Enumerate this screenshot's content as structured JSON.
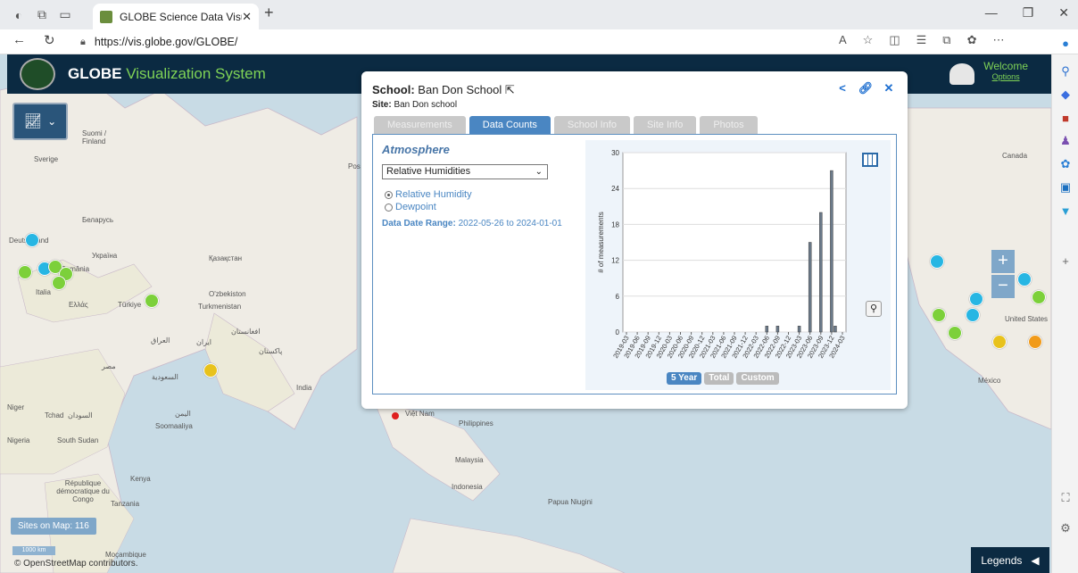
{
  "browser": {
    "tab_title": "GLOBE Science Data Visualizatio",
    "url": "https://vis.globe.gov/GLOBE/"
  },
  "app": {
    "title_main": "GLOBE",
    "title_sub": "Visualization System",
    "welcome": "Welcome",
    "options": "Options",
    "sites_on_map": "Sites on Map: 116",
    "scale": "1000 km",
    "attribution": "© OpenStreetMap contributors.",
    "legends": "Legends"
  },
  "map_labels": [
    "Suomi / Finland",
    "Sverige",
    "Беларусь",
    "Україна",
    "Қазақстан",
    "Italia",
    "România",
    "Ελλάς",
    "Türkiye",
    "O'zbekiston",
    "Turkmenistan",
    "العراق",
    "ایران",
    "افغانستان",
    "پاکستان",
    "مصر",
    "السعودية",
    "India",
    "Niger",
    "Tchad",
    "السودان",
    "اليمن",
    "Nigeria",
    "South Sudan",
    "Soomaaliya",
    "Kenya",
    "République démocratique du Congo",
    "Tanzania",
    "Moçambique",
    "Việt Nam",
    "Philippines",
    "Malaysia",
    "Indonesia",
    "Papua Niugini",
    "Canada",
    "United States",
    "México",
    "Pos",
    "Deutschland"
  ],
  "popup": {
    "school_label": "School:",
    "school_name": "Ban Don School",
    "site_label": "Site:",
    "site_name": "Ban Don school",
    "tabs": [
      "Measurements",
      "Data Counts",
      "School Info",
      "Site Info",
      "Photos"
    ],
    "active_tab": "Data Counts",
    "section": "Atmosphere",
    "select_value": "Relative Humidities",
    "radio_options": [
      "Relative Humidity",
      "Dewpoint"
    ],
    "selected_radio": "Relative Humidity",
    "date_range_label": "Data Date Range:",
    "date_range_value": "2022-05-26 to 2024-01-01",
    "range_buttons": [
      "5 Year",
      "Total",
      "Custom"
    ],
    "active_range": "5 Year"
  },
  "chart_data": {
    "type": "bar",
    "ylabel": "# of measurements",
    "xlabel": "",
    "ylim": [
      0,
      30
    ],
    "yticks": [
      0,
      6,
      12,
      18,
      24,
      30
    ],
    "categories": [
      "2019-03",
      "2019-06",
      "2019-09",
      "2019-12",
      "2020-03",
      "2020-06",
      "2020-09",
      "2020-12",
      "2021-03",
      "2021-06",
      "2021-09",
      "2021-12",
      "2022-03",
      "2022-06",
      "2022-09",
      "2022-12",
      "2023-03",
      "2023-06",
      "2023-09",
      "2023-12",
      "2024-03"
    ],
    "x": [
      "2022-06",
      "2022-09",
      "2023-03",
      "2023-06",
      "2023-09",
      "2023-12",
      "2024-01"
    ],
    "values": [
      1,
      1,
      1,
      15,
      20,
      27,
      1
    ],
    "grid": true
  },
  "colors": {
    "header": "#0b2a42",
    "accent_green": "#7fd356",
    "tab_active": "#4a86c2",
    "bar": "#6b7a8a"
  }
}
